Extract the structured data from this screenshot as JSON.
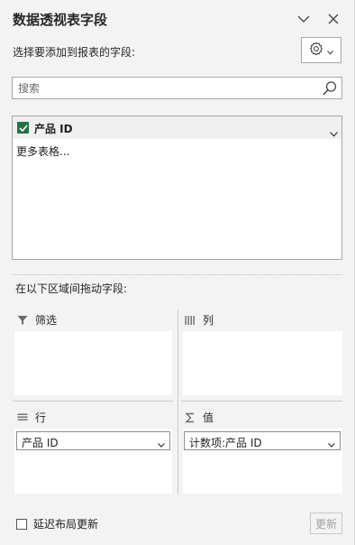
{
  "pane": {
    "title": "数据透视表字段",
    "collapse_icon": "chevron-down-icon",
    "close_icon": "close-icon"
  },
  "field_chooser": {
    "label": "选择要添加到报表的字段:",
    "tools_icon": "gear-icon",
    "tools_dropdown_icon": "caret-down-icon"
  },
  "search": {
    "placeholder": "搜索",
    "value": "",
    "icon": "search-icon"
  },
  "field_list": {
    "items": [
      {
        "label": "产品 ID",
        "checked": true,
        "expand_icon": "chevron-down-icon"
      }
    ],
    "more_tables_label": "更多表格..."
  },
  "areas": {
    "drag_label": "在以下区域间拖动字段:",
    "filters": {
      "label": "筛选",
      "icon": "filter-icon",
      "items": []
    },
    "columns": {
      "label": "列",
      "icon": "columns-icon",
      "items": []
    },
    "rows": {
      "label": "行",
      "icon": "rows-icon",
      "items": [
        "产品 ID"
      ]
    },
    "values": {
      "label": "值",
      "icon": "sigma-icon",
      "items": [
        "计数项:产品 ID"
      ]
    }
  },
  "footer": {
    "defer_label": "延迟布局更新",
    "defer_checked": false,
    "update_label": "更新",
    "update_enabled": false
  },
  "colors": {
    "accent_green": "#217346",
    "pane_background": "#f3f3f3",
    "border": "#a6a6a6"
  }
}
